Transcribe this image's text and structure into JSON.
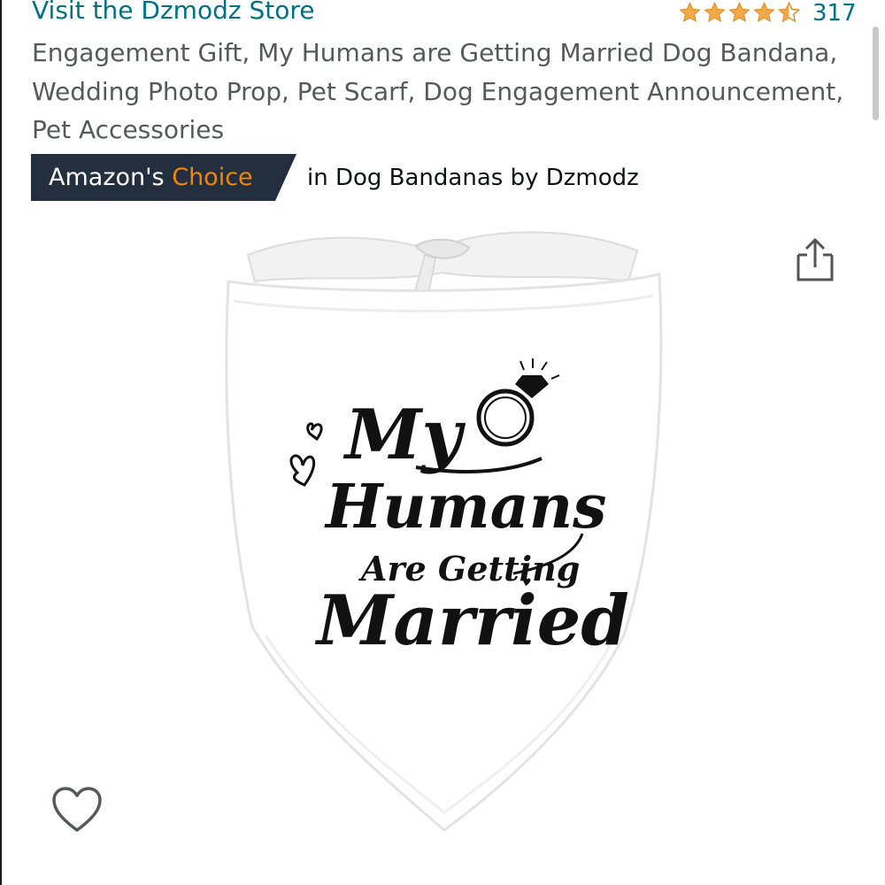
{
  "store": {
    "link_label": "Visit the Dzmodz Store"
  },
  "rating": {
    "stars": 4.5,
    "count": "317",
    "star_color": "#f3a847"
  },
  "product": {
    "title": "Engagement Gift, My Humans are Getting Married Dog Bandana, Wedding Photo Prop, Pet Scarf, Dog Engagement Announcement, Pet Accessories"
  },
  "badge": {
    "prefix": "Amazon's",
    "highlight": "Choice",
    "category_text": "in Dog Bandanas by Dzmodz",
    "badge_color": "#232f3e",
    "highlight_color": "#f08804"
  },
  "image": {
    "print_line1": "My",
    "print_line2": "Humans",
    "print_line3": "Are Getting",
    "print_line4": "Married"
  },
  "icons": {
    "share": "share-icon",
    "wishlist": "heart-outline-icon",
    "ring": "diamond-ring-icon"
  },
  "colors": {
    "link": "#007185",
    "title": "#565959"
  }
}
